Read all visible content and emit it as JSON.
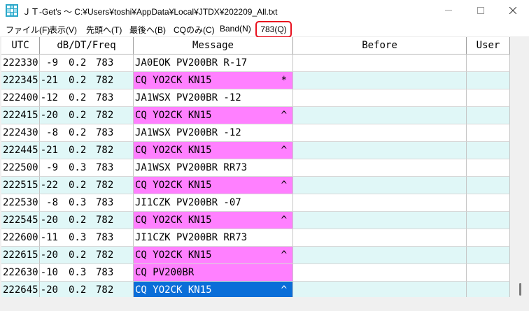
{
  "window": {
    "title": "ＪＴ-Get's 〜 C:¥Users¥toshi¥AppData¥Local¥JTDX¥202209_All.txt",
    "app_icon": "jt-get-app-icon"
  },
  "menu": [
    {
      "label": "ファイル(F)"
    },
    {
      "label": "表示(V)"
    },
    {
      "label": "先頭へ(T)"
    },
    {
      "label": "最後へ(B)"
    },
    {
      "label": "CQのみ(C)"
    },
    {
      "label": "Band(N)"
    }
  ],
  "menu_highlight": {
    "label": "783(Q)",
    "border_color": "#e8101e"
  },
  "table": {
    "headers": {
      "utc": "UTC",
      "db_dt_freq": "dB/DT/Freq",
      "message": "Message",
      "before": "Before",
      "user": "User"
    },
    "rows": [
      {
        "utc": "222330",
        "db": "-9",
        "dt": "0.2",
        "freq": "783",
        "message": "JA0EOK PV200BR R-17",
        "mark": "",
        "cq": false,
        "alt": false,
        "selected": false
      },
      {
        "utc": "222345",
        "db": "-21",
        "dt": "0.2",
        "freq": "782",
        "message": "CQ YO2CK KN15",
        "mark": "*",
        "cq": true,
        "alt": true,
        "selected": false
      },
      {
        "utc": "222400",
        "db": "-12",
        "dt": "0.2",
        "freq": "783",
        "message": "JA1WSX PV200BR -12",
        "mark": "",
        "cq": false,
        "alt": false,
        "selected": false
      },
      {
        "utc": "222415",
        "db": "-20",
        "dt": "0.2",
        "freq": "782",
        "message": "CQ YO2CK KN15",
        "mark": "^",
        "cq": true,
        "alt": true,
        "selected": false
      },
      {
        "utc": "222430",
        "db": "-8",
        "dt": "0.2",
        "freq": "783",
        "message": "JA1WSX PV200BR -12",
        "mark": "",
        "cq": false,
        "alt": false,
        "selected": false
      },
      {
        "utc": "222445",
        "db": "-21",
        "dt": "0.2",
        "freq": "782",
        "message": "CQ YO2CK KN15",
        "mark": "^",
        "cq": true,
        "alt": true,
        "selected": false
      },
      {
        "utc": "222500",
        "db": "-9",
        "dt": "0.3",
        "freq": "783",
        "message": "JA1WSX PV200BR RR73",
        "mark": "",
        "cq": false,
        "alt": false,
        "selected": false
      },
      {
        "utc": "222515",
        "db": "-22",
        "dt": "0.2",
        "freq": "782",
        "message": "CQ YO2CK KN15",
        "mark": "^",
        "cq": true,
        "alt": true,
        "selected": false
      },
      {
        "utc": "222530",
        "db": "-8",
        "dt": "0.3",
        "freq": "783",
        "message": "JI1CZK PV200BR -07",
        "mark": "",
        "cq": false,
        "alt": false,
        "selected": false
      },
      {
        "utc": "222545",
        "db": "-20",
        "dt": "0.2",
        "freq": "782",
        "message": "CQ YO2CK KN15",
        "mark": "^",
        "cq": true,
        "alt": true,
        "selected": false
      },
      {
        "utc": "222600",
        "db": "-11",
        "dt": "0.3",
        "freq": "783",
        "message": "JI1CZK PV200BR RR73",
        "mark": "",
        "cq": false,
        "alt": false,
        "selected": false
      },
      {
        "utc": "222615",
        "db": "-20",
        "dt": "0.2",
        "freq": "782",
        "message": "CQ YO2CK KN15",
        "mark": "^",
        "cq": true,
        "alt": true,
        "selected": false
      },
      {
        "utc": "222630",
        "db": "-10",
        "dt": "0.3",
        "freq": "783",
        "message": "CQ PV200BR",
        "mark": "",
        "cq": true,
        "alt": false,
        "selected": false
      },
      {
        "utc": "222645",
        "db": "-20",
        "dt": "0.2",
        "freq": "782",
        "message": "CQ YO2CK KN15",
        "mark": "^",
        "cq": true,
        "alt": true,
        "selected": true
      }
    ]
  },
  "colors": {
    "cq_message": "#ff80ff",
    "alt_row": "#e0f7f7",
    "selected": "#0a6ed8"
  }
}
